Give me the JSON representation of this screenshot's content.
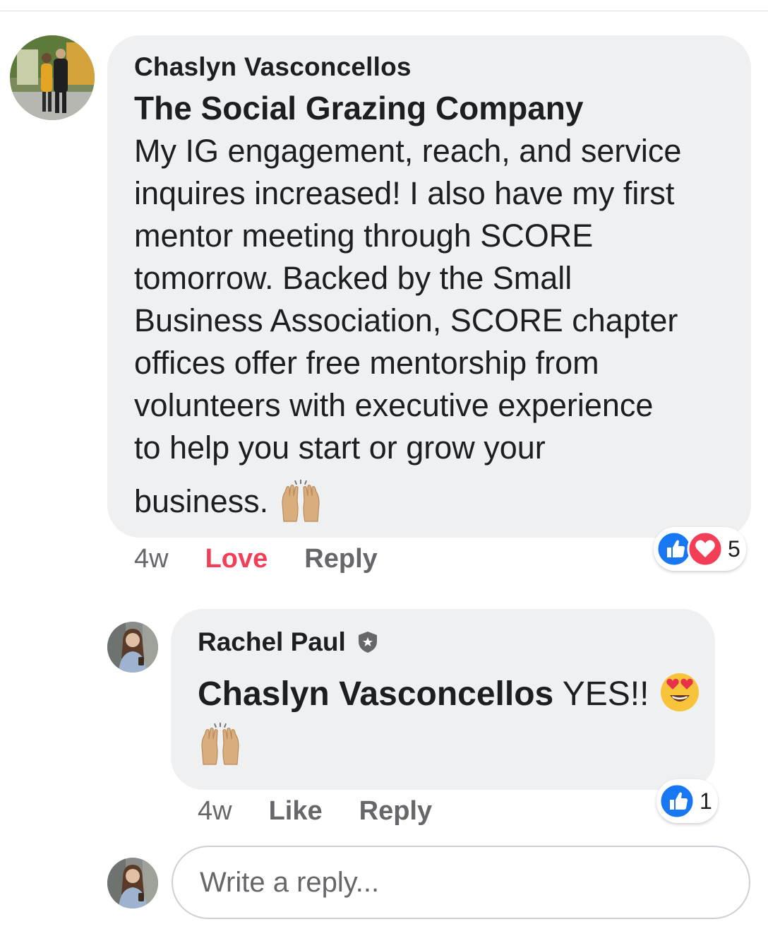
{
  "colors": {
    "bubble": "#eff0f2",
    "secondary_text": "#65676b",
    "love": "#f33e58",
    "like_blue": "#1877f2"
  },
  "comment": {
    "author": "Chaslyn Vasconcellos",
    "tagged_page": "The Social Grazing Company",
    "body_lines": [
      "My IG engagement, reach, and service",
      "inquires increased!  I also have my first",
      "mentor meeting through SCORE",
      "tomorrow.  Backed by the Small",
      "Business Association, SCORE chapter",
      "offices offer free mentorship from",
      "volunteers with executive experience",
      "to help you start or grow your",
      "business."
    ],
    "emoji": "raising-hands-icon",
    "time": "4w",
    "love_label": "Love",
    "reply_label": "Reply",
    "reactions": {
      "icons": [
        "like-icon",
        "heart-icon"
      ],
      "count": "5"
    }
  },
  "reply": {
    "author": "Rachel Paul",
    "badge": "shield-star-icon",
    "mention": "Chaslyn Vasconcellos",
    "text": " YES!!",
    "emojis": [
      "heart-eyes-icon",
      "raising-hands-icon"
    ],
    "time": "4w",
    "like_label": "Like",
    "reply_label": "Reply",
    "reactions": {
      "icons": [
        "like-icon"
      ],
      "count": "1"
    }
  },
  "composer": {
    "placeholder": "Write a reply..."
  }
}
